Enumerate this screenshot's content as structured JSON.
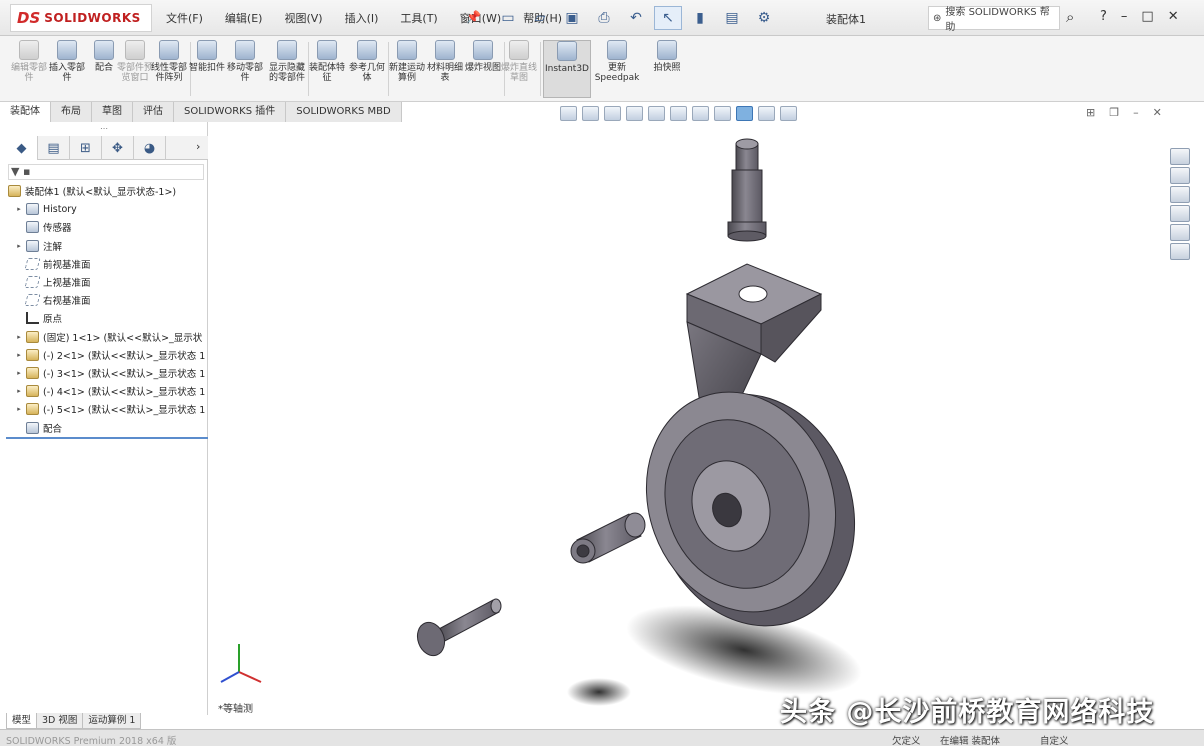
{
  "app": {
    "logo_text": "SOLIDWORKS",
    "doc_title": "装配体1",
    "menus": [
      "文件(F)",
      "编辑(E)",
      "视图(V)",
      "插入(I)",
      "工具(T)",
      "窗口(W)",
      "帮助(H)"
    ],
    "search_placeholder": "搜索 SOLIDWORKS 帮助",
    "window_buttons": [
      "?",
      "–",
      "□",
      "✕"
    ]
  },
  "ribbon": {
    "buttons": [
      {
        "label": "编辑零部件",
        "dim": true
      },
      {
        "label": "插入零部件",
        "dim": false
      },
      {
        "label": "配合",
        "dim": false
      },
      {
        "label": "零部件预览窗口",
        "dim": true
      },
      {
        "label": "线性零部件阵列",
        "dim": false
      },
      {
        "label": "智能扣件",
        "dim": false
      },
      {
        "label": "移动零部件",
        "dim": false
      },
      {
        "label": "显示隐藏的零部件",
        "dim": false
      },
      {
        "label": "装配体特征",
        "dim": false
      },
      {
        "label": "参考几何体",
        "dim": false
      },
      {
        "label": "新建运动算例",
        "dim": false
      },
      {
        "label": "材料明细表",
        "dim": false
      },
      {
        "label": "爆炸视图",
        "dim": false
      },
      {
        "label": "爆炸直线草图",
        "dim": true
      },
      {
        "label": "Instant3D",
        "dim": false,
        "active": true
      },
      {
        "label": "更新 Speedpak",
        "dim": false
      },
      {
        "label": "拍快照",
        "dim": false
      }
    ]
  },
  "command_tabs": [
    {
      "label": "装配体",
      "active": true
    },
    {
      "label": "布局",
      "active": false
    },
    {
      "label": "草图",
      "active": false
    },
    {
      "label": "评估",
      "active": false
    },
    {
      "label": "SOLIDWORKS 插件",
      "active": false
    },
    {
      "label": "SOLIDWORKS MBD",
      "active": false
    }
  ],
  "feature_tree": {
    "filter_text": "▼ ▪",
    "root": "装配体1 (默认<默认_显示状态-1>)",
    "items": [
      {
        "label": "History",
        "exp": true,
        "icon": "history"
      },
      {
        "label": "传感器",
        "exp": false,
        "icon": "sensor"
      },
      {
        "label": "注解",
        "exp": true,
        "icon": "annotation"
      },
      {
        "label": "前视基准面",
        "exp": false,
        "icon": "plane"
      },
      {
        "label": "上视基准面",
        "exp": false,
        "icon": "plane"
      },
      {
        "label": "右视基准面",
        "exp": false,
        "icon": "plane"
      },
      {
        "label": "原点",
        "exp": false,
        "icon": "origin"
      },
      {
        "label": "(固定) 1<1> (默认<<默认>_显示状",
        "exp": true,
        "icon": "part"
      },
      {
        "label": "(-) 2<1> (默认<<默认>_显示状态 1",
        "exp": true,
        "icon": "part"
      },
      {
        "label": "(-) 3<1> (默认<<默认>_显示状态 1",
        "exp": true,
        "icon": "part"
      },
      {
        "label": "(-) 4<1> (默认<<默认>_显示状态 1",
        "exp": true,
        "icon": "part"
      },
      {
        "label": "(-) 5<1> (默认<<默认>_显示状态 1",
        "exp": true,
        "icon": "part"
      },
      {
        "label": "配合",
        "exp": false,
        "icon": "mates"
      }
    ]
  },
  "bottom_tabs": [
    {
      "label": "模型",
      "active": true
    },
    {
      "label": "3D 视图",
      "active": false
    },
    {
      "label": "运动算例 1",
      "active": false
    }
  ],
  "viewport": {
    "triad_label": "*等轴测"
  },
  "status": {
    "app_version": "SOLIDWORKS Premium 2018 x64 版",
    "state": "欠定义",
    "mode": "在编辑 装配体",
    "units": "自定义"
  },
  "watermark": "头条 @长沙前桥教育网络科技"
}
